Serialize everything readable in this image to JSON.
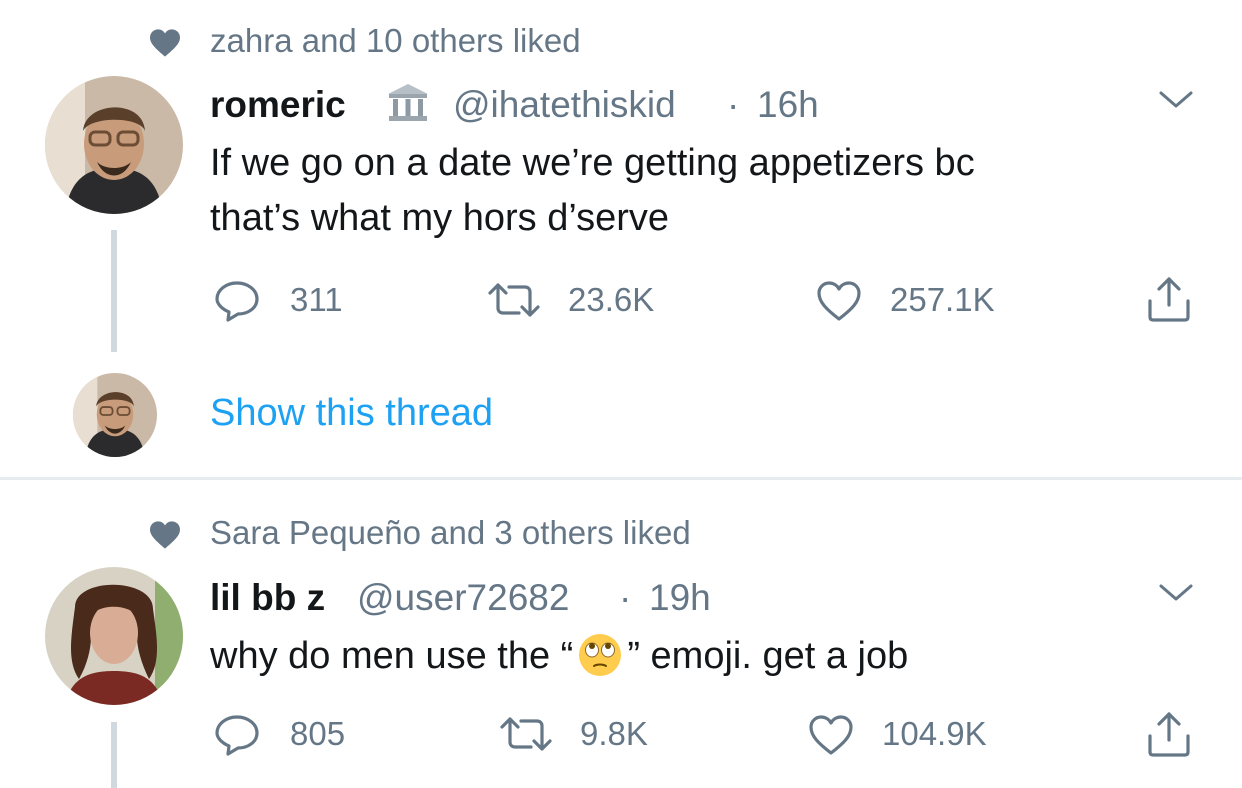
{
  "tweets": [
    {
      "social_context": "zahra and 10 others liked",
      "display_name": "romeric",
      "name_emoji": "classical-building-emoji",
      "handle": "@ihatethiskid",
      "separator": "·",
      "time": "16h",
      "text_lines": [
        "If we go on a date we’re getting appetizers bc",
        "that’s what my hors d’serve"
      ],
      "replies": "311",
      "retweets": "23.6K",
      "likes": "257.1K",
      "show_thread_label": "Show this thread"
    },
    {
      "social_context": "Sara Pequeño and 3 others liked",
      "display_name": "lil bb z",
      "handle": "@user72682",
      "separator": "·",
      "time": "19h",
      "text_before_emoji": "why do men use the “",
      "text_emoji": "face-with-rolling-eyes-emoji",
      "text_after_emoji": "” emoji. get a job",
      "replies": "805",
      "retweets": "9.8K",
      "likes": "104.9K"
    }
  ],
  "colors": {
    "secondary_text": "#657786",
    "link": "#1da1f2",
    "thread_line": "#cfd9de",
    "divider": "#e6ecf0"
  }
}
